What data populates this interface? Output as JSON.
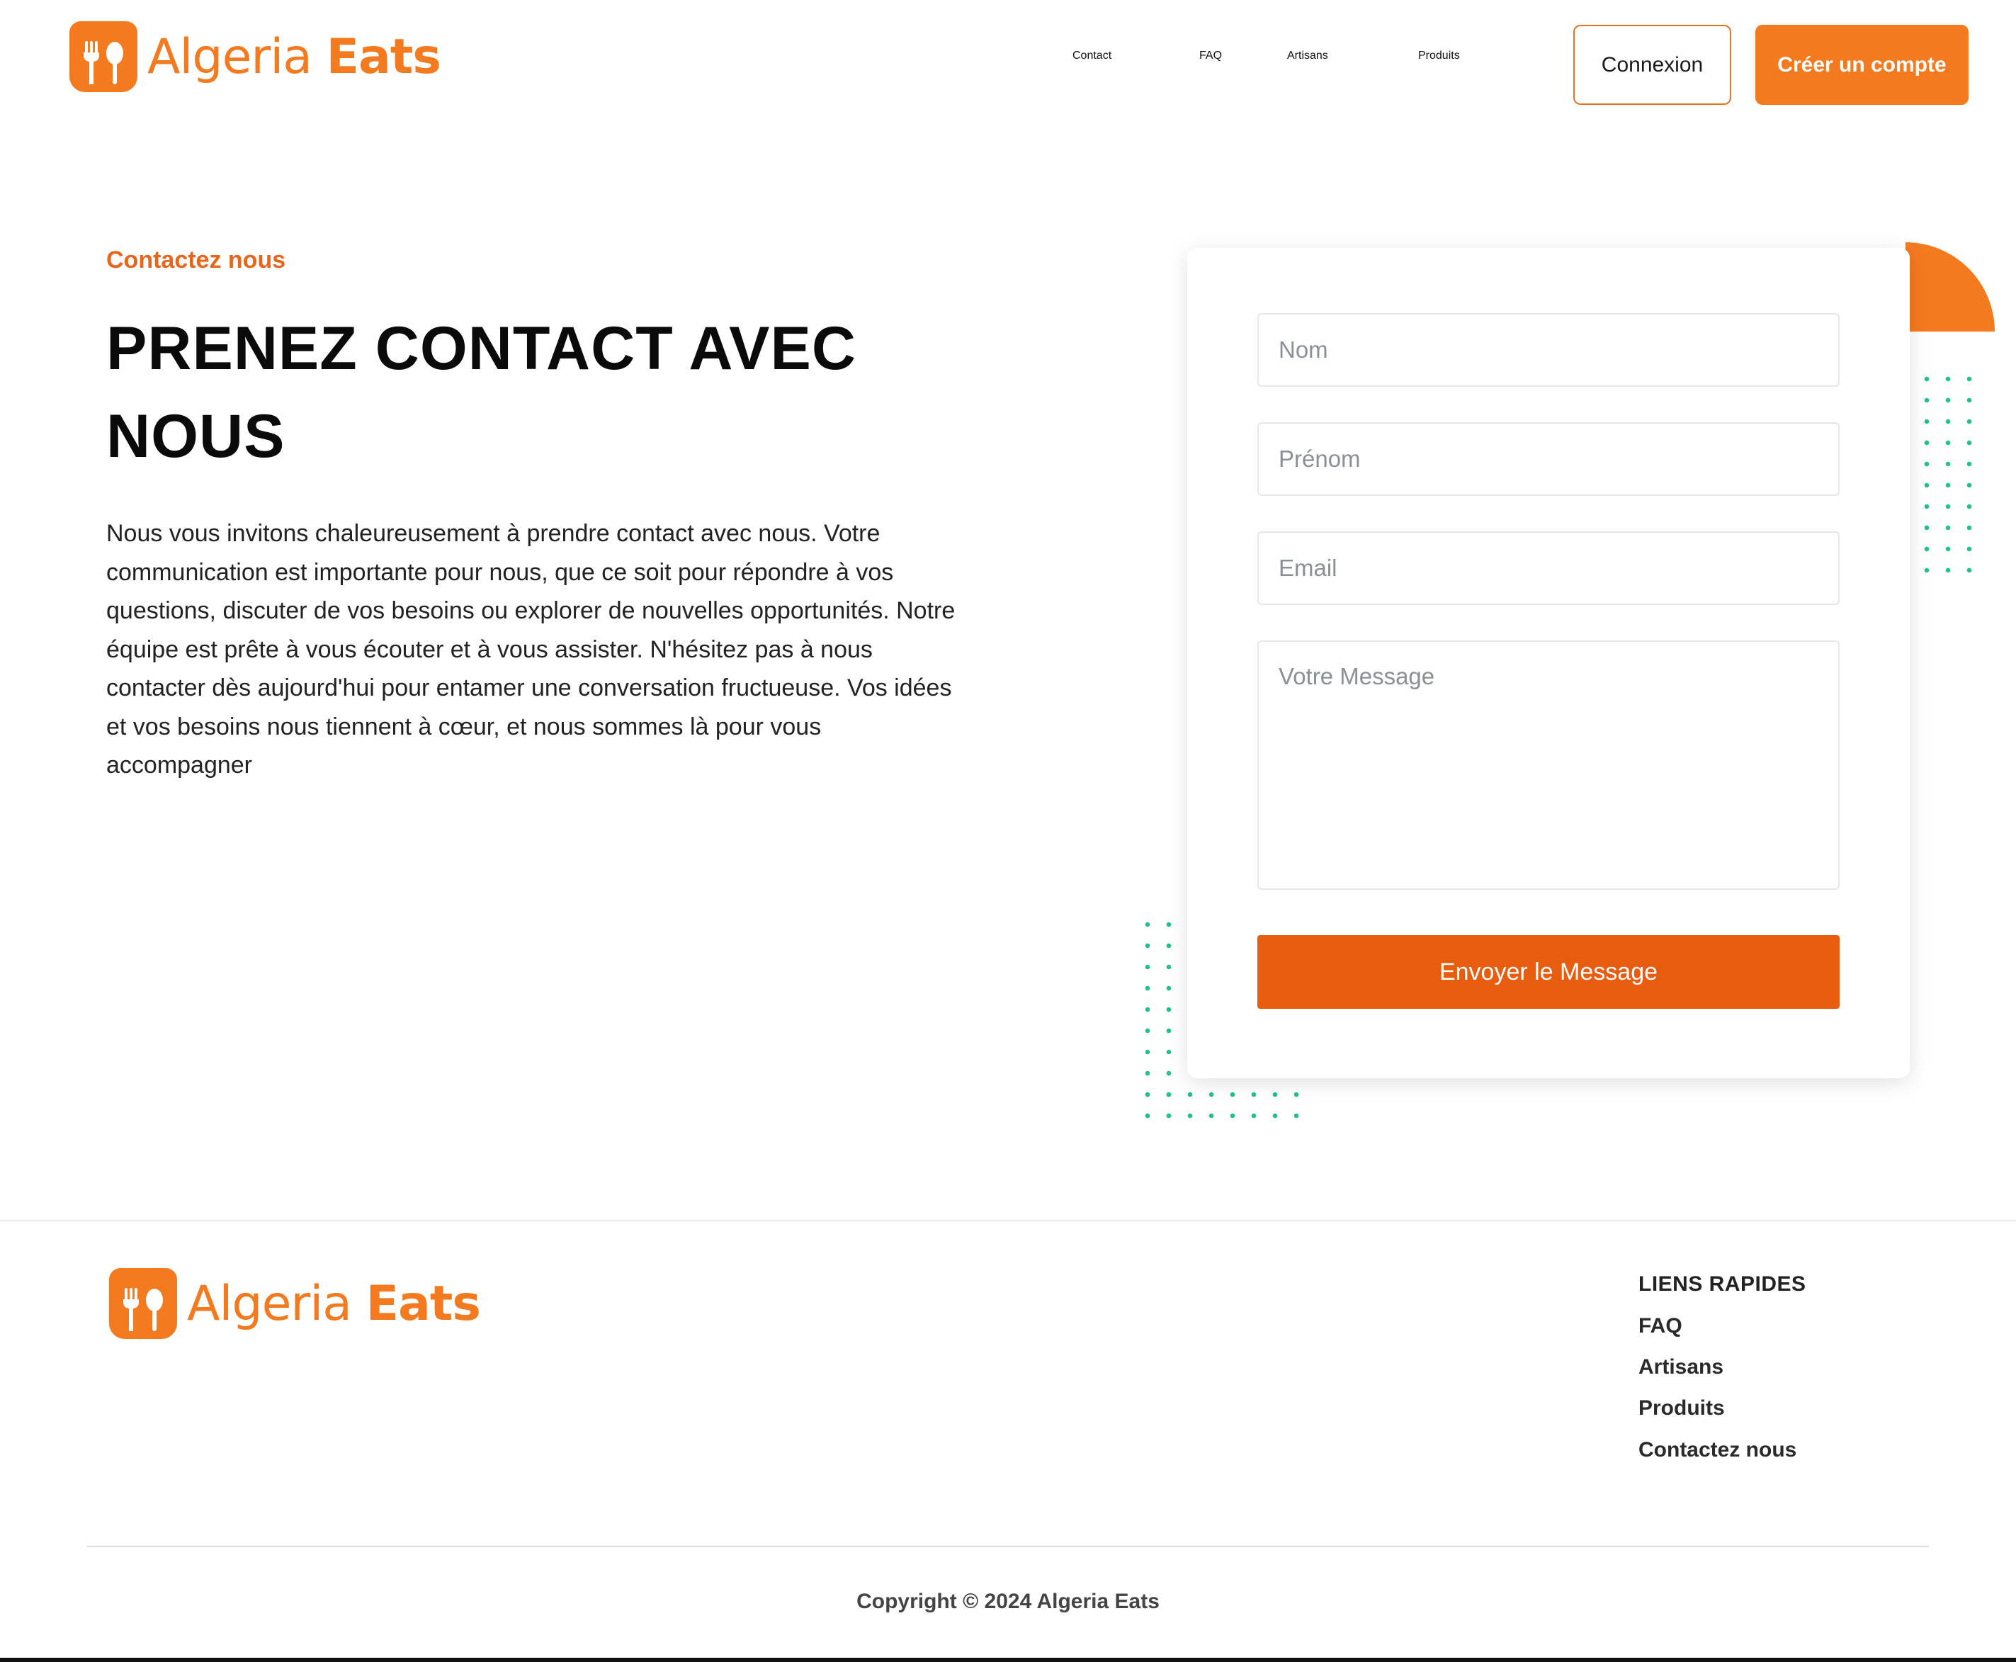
{
  "brand": {
    "name_part1": "Algeria",
    "name_part2": "Eats",
    "color": "#f47a20"
  },
  "nav": {
    "items": [
      {
        "label": "Contact"
      },
      {
        "label": "FAQ"
      },
      {
        "label": "Artisans"
      },
      {
        "label": "Produits"
      }
    ],
    "login_label": "Connexion",
    "signup_label": "Créer un compte"
  },
  "contact": {
    "eyebrow": "Contactez nous",
    "heading_line1": "PRENEZ CONTACT AVEC",
    "heading_line2": "NOUS",
    "intro": "Nous vous invitons chaleureusement à prendre contact avec nous. Votre communication est importante pour nous, que ce soit pour répondre à vos questions, discuter de vos besoins ou explorer de nouvelles opportunités. Notre équipe est prête à vous écouter et à vous assister. N'hésitez pas à nous contacter dès aujourd'hui pour entamer une conversation fructueuse. Vos idées et vos besoins nous tiennent à cœur, et nous sommes là pour vous accompagner"
  },
  "form": {
    "nom_placeholder": "Nom",
    "prenom_placeholder": "Prénom",
    "email_placeholder": "Email",
    "message_placeholder": "Votre Message",
    "submit_label": "Envoyer le Message",
    "submit_color": "#e85c10"
  },
  "footer": {
    "links_title": "LIENS RAPIDES",
    "links": [
      {
        "label": "FAQ"
      },
      {
        "label": "Artisans"
      },
      {
        "label": "Produits"
      },
      {
        "label": "Contactez nous"
      }
    ],
    "copyright": "Copyright © 2024  Algeria Eats"
  },
  "decor": {
    "dot_color": "#20c08f",
    "accent_shape": "orange-quarter-circle"
  }
}
